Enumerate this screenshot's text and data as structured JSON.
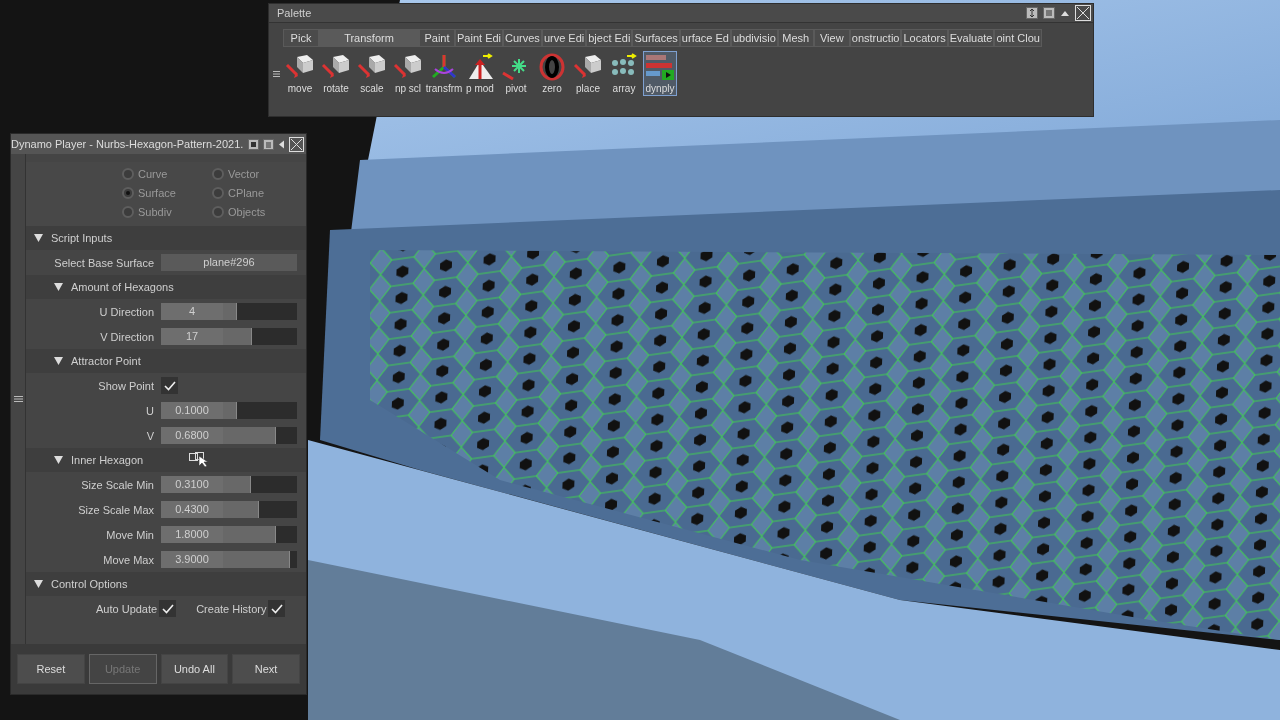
{
  "palette": {
    "title": "Palette",
    "tabs": [
      {
        "label": "Pick",
        "selected": false
      },
      {
        "label": "Transform",
        "selected": true
      },
      {
        "label": "Paint",
        "selected": false
      },
      {
        "label": "Paint Edi",
        "selected": false
      },
      {
        "label": "Curves",
        "selected": false
      },
      {
        "label": "urve Edi",
        "selected": false
      },
      {
        "label": "bject Edi",
        "selected": false
      },
      {
        "label": "Surfaces",
        "selected": false
      },
      {
        "label": "urface Ed",
        "selected": false
      },
      {
        "label": "ubdivisio",
        "selected": false
      },
      {
        "label": "Mesh",
        "selected": false
      },
      {
        "label": "View",
        "selected": false
      },
      {
        "label": "onstructio",
        "selected": false
      },
      {
        "label": "Locators",
        "selected": false
      },
      {
        "label": "Evaluate",
        "selected": false
      },
      {
        "label": "oint Clou",
        "selected": false
      }
    ],
    "tools": [
      {
        "label": "move",
        "selected": false
      },
      {
        "label": "rotate",
        "selected": false
      },
      {
        "label": "scale",
        "selected": false
      },
      {
        "label": "np scl",
        "selected": false
      },
      {
        "label": "transfrm",
        "selected": false
      },
      {
        "label": "p mod",
        "selected": false
      },
      {
        "label": "pivot",
        "selected": false
      },
      {
        "label": "zero",
        "selected": false
      },
      {
        "label": "place",
        "selected": false
      },
      {
        "label": "array",
        "selected": false
      },
      {
        "label": "dynply",
        "selected": true
      }
    ]
  },
  "player": {
    "title": "Dynamo Player - Nurbs-Hexagon-Pattern-2021.",
    "radios": [
      {
        "label": "Curve",
        "selected": false
      },
      {
        "label": "Vector",
        "selected": false
      },
      {
        "label": "Surface",
        "selected": true
      },
      {
        "label": "CPlane",
        "selected": false
      },
      {
        "label": "Subdiv",
        "selected": false
      },
      {
        "label": "Objects",
        "selected": false
      }
    ],
    "script_inputs": {
      "title": "Script Inputs",
      "expanded": true,
      "rows": [
        {
          "kind": "field",
          "label": "Select Base Surface",
          "value": "plane#296"
        }
      ],
      "groups": [
        {
          "title": "Amount of Hexagons",
          "expanded": true,
          "cursor": false,
          "rows": [
            {
              "kind": "slider",
              "label": "U Direction",
              "value": "4",
              "level": 0.19
            },
            {
              "kind": "slider",
              "label": "V Direction",
              "value": "17",
              "level": 0.39
            }
          ]
        },
        {
          "title": "Attractor Point",
          "expanded": true,
          "cursor": false,
          "rows": [
            {
              "kind": "check",
              "label": "Show Point",
              "checked": true
            },
            {
              "kind": "slider",
              "label": "U",
              "value": "0.1000",
              "level": 0.19
            },
            {
              "kind": "slider",
              "label": "V",
              "value": "0.6800",
              "level": 0.72
            }
          ]
        },
        {
          "title": "Inner Hexagon",
          "expanded": true,
          "cursor": true,
          "rows": [
            {
              "kind": "slider",
              "label": "Size Scale Min",
              "value": "0.3100",
              "level": 0.38
            },
            {
              "kind": "slider",
              "label": "Size Scale Max",
              "value": "0.4300",
              "level": 0.49
            },
            {
              "kind": "slider",
              "label": "Move Min",
              "value": "1.8000",
              "level": 0.72
            },
            {
              "kind": "slider",
              "label": "Move Max",
              "value": "3.9000",
              "level": 0.9
            }
          ]
        }
      ]
    },
    "control_options": {
      "title": "Control Options",
      "expanded": true,
      "checks": [
        {
          "label": "Auto Update",
          "checked": true
        },
        {
          "label": "Create History",
          "checked": true
        }
      ]
    },
    "buttons": [
      {
        "label": "Reset",
        "disabled": false
      },
      {
        "label": "Update",
        "disabled": true
      },
      {
        "label": "Undo All",
        "disabled": false
      },
      {
        "label": "Next",
        "disabled": false
      }
    ]
  }
}
